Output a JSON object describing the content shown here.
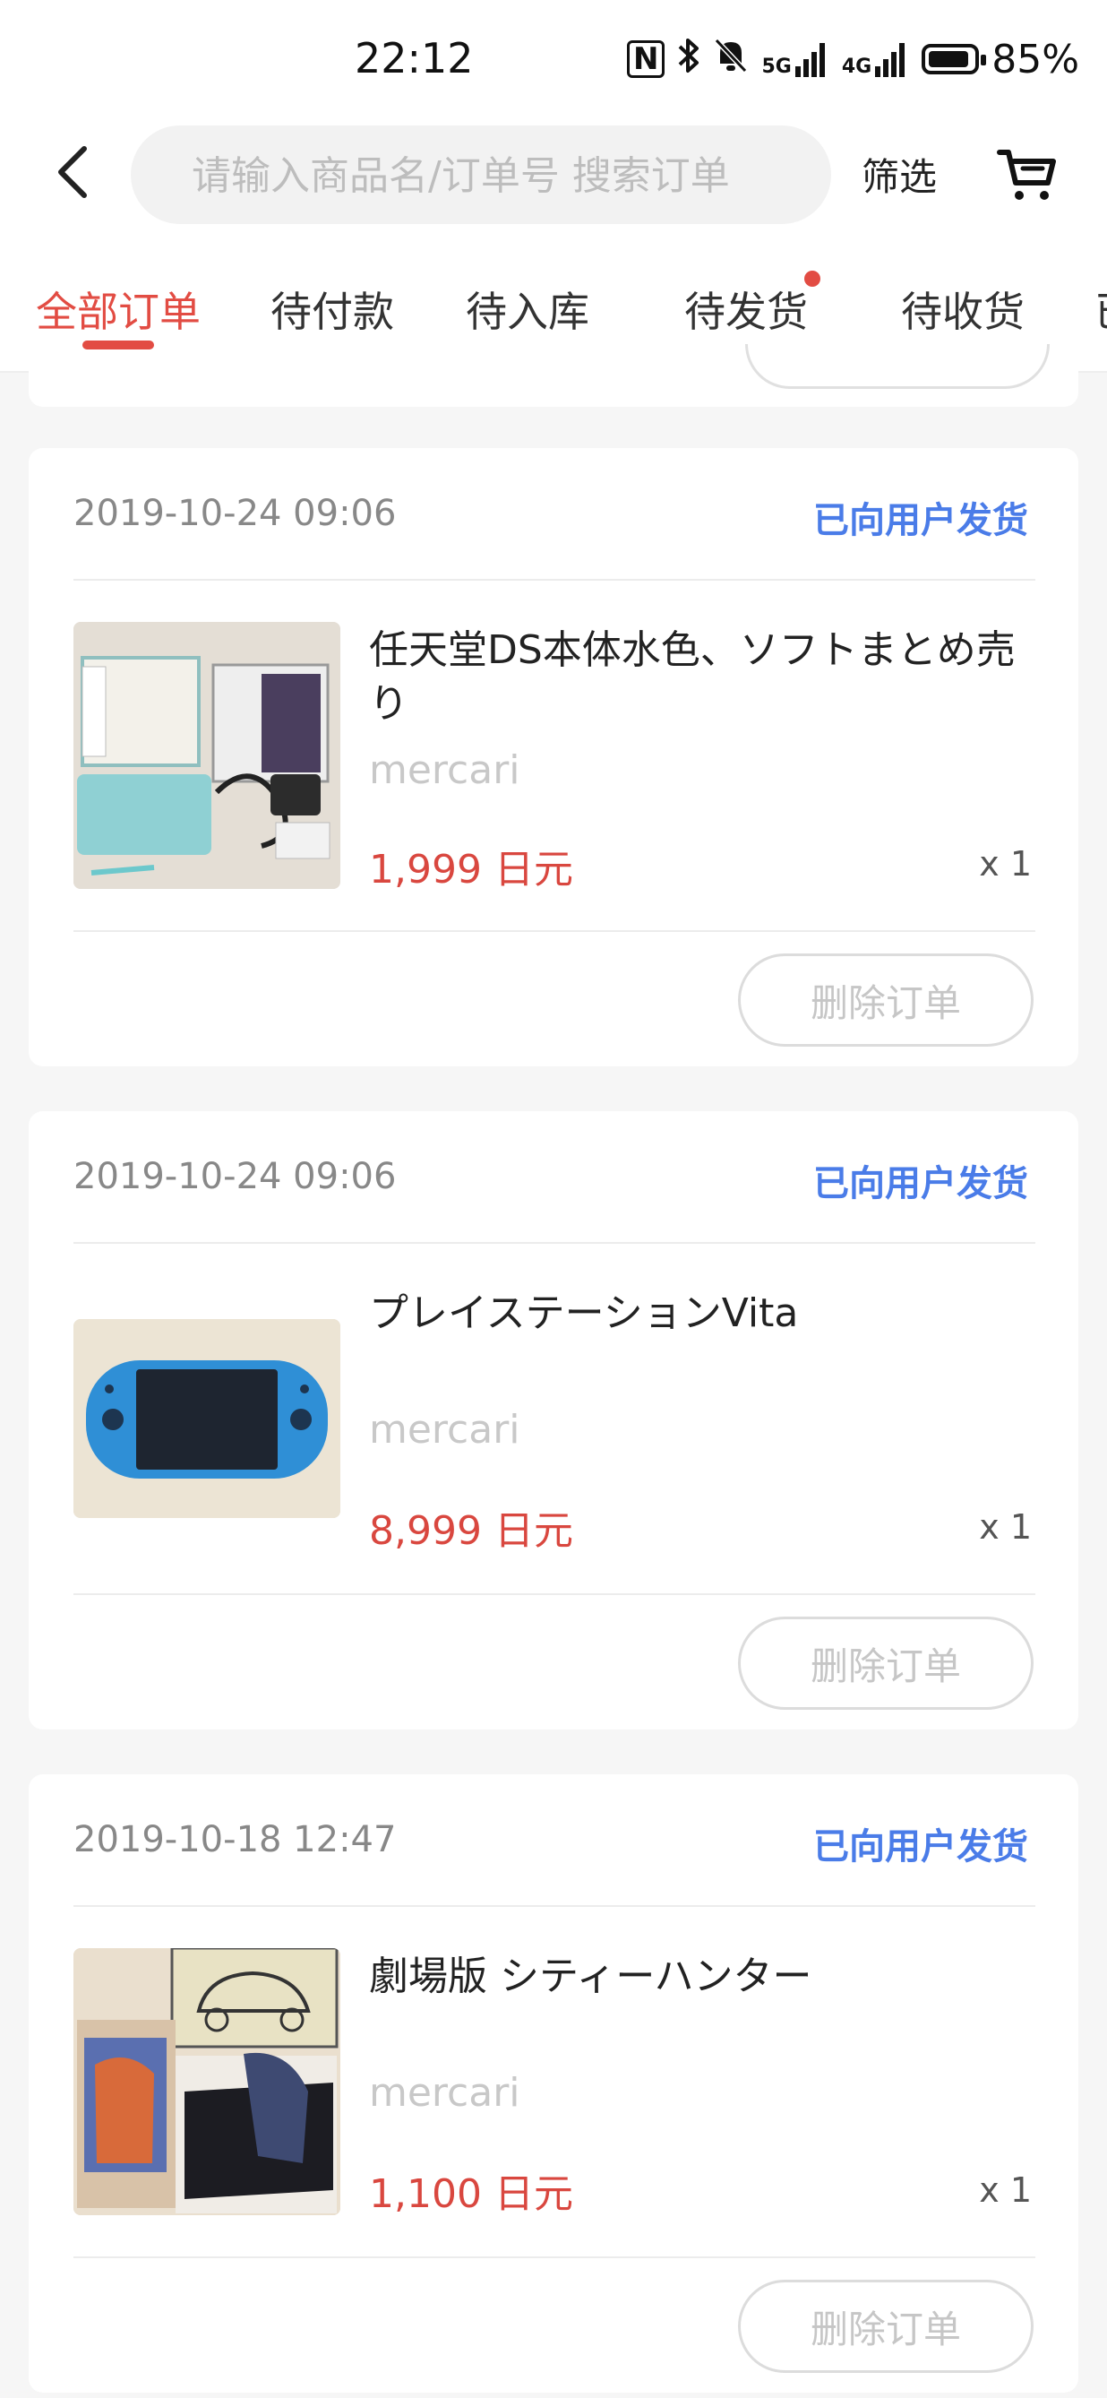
{
  "status_bar": {
    "time": "22:12",
    "battery": "85%",
    "signal_5g": "5G",
    "signal_4g": "4G",
    "icons": [
      "nfc-icon",
      "bluetooth-icon",
      "bell-off-icon",
      "signal-5g-icon",
      "signal-4g-icon",
      "battery-icon"
    ]
  },
  "header": {
    "search_placeholder": "请输入商品名/订单号 搜索订单",
    "filter_label": "筛选"
  },
  "tabs": [
    {
      "label": "全部订单",
      "active": true
    },
    {
      "label": "待付款"
    },
    {
      "label": "待入库"
    },
    {
      "label": "待发货",
      "has_badge": true
    },
    {
      "label": "待收货"
    },
    {
      "label": "已"
    }
  ],
  "orders": [
    {
      "date": "2019-10-24 09:06",
      "status": "已向用户发货",
      "name": "任天堂DS本体水色、ソフトまとめ売り",
      "seller": "mercari",
      "price": "1,999 日元",
      "qty": "x 1",
      "delete_label": "删除订单"
    },
    {
      "date": "2019-10-24 09:06",
      "status": "已向用户发货",
      "name": "プレイステーションVita",
      "seller": "mercari",
      "price": "8,999 日元",
      "qty": "x 1",
      "delete_label": "删除订单"
    },
    {
      "date": "2019-10-18 12:47",
      "status": "已向用户发货",
      "name": "劇場版 シティーハンター",
      "seller": "mercari",
      "price": "1,100 日元",
      "qty": "x 1",
      "delete_label": "删除订单"
    }
  ],
  "colors": {
    "accent_red": "#e24c43",
    "status_blue": "#4a7ce8",
    "price_red": "#d9473f"
  }
}
